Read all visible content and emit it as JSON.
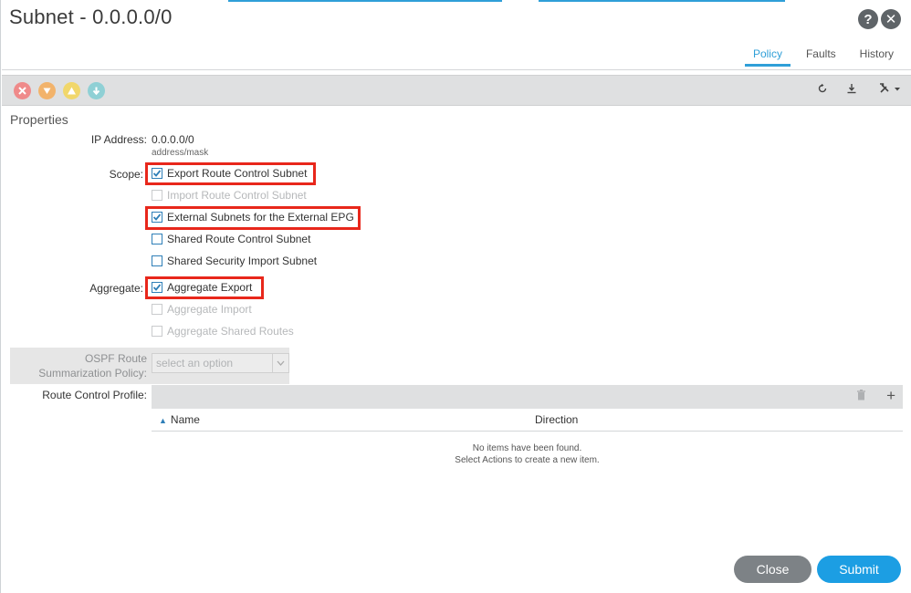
{
  "window": {
    "title": "Subnet - 0.0.0.0/0",
    "help_icon": "?",
    "close_icon": "✕"
  },
  "tabs": [
    {
      "label": "Policy",
      "active": true
    },
    {
      "label": "Faults",
      "active": false
    },
    {
      "label": "History",
      "active": false
    }
  ],
  "toolbar": {
    "fault_icons": [
      "critical-fault-icon",
      "major-fault-icon",
      "minor-fault-icon",
      "warning-fault-icon"
    ],
    "tools": [
      "refresh-icon",
      "download-icon",
      "tools-menu-icon"
    ]
  },
  "properties": {
    "section_title": "Properties",
    "ip_address": {
      "label": "IP Address:",
      "value": "0.0.0.0/0",
      "hint": "address/mask"
    },
    "scope": {
      "label": "Scope:",
      "options": [
        {
          "label": "Export Route Control Subnet",
          "checked": true,
          "disabled": false
        },
        {
          "label": "Import Route Control Subnet",
          "checked": false,
          "disabled": true
        },
        {
          "label": "External Subnets for the External EPG",
          "checked": true,
          "disabled": false
        },
        {
          "label": "Shared Route Control Subnet",
          "checked": false,
          "disabled": false
        },
        {
          "label": "Shared Security Import Subnet",
          "checked": false,
          "disabled": false
        }
      ]
    },
    "aggregate": {
      "label": "Aggregate:",
      "options": [
        {
          "label": "Aggregate Export",
          "checked": true,
          "disabled": false
        },
        {
          "label": "Aggregate Import",
          "checked": false,
          "disabled": true
        },
        {
          "label": "Aggregate Shared Routes",
          "checked": false,
          "disabled": true
        }
      ]
    },
    "ospf": {
      "label_line1": "OSPF Route",
      "label_line2": "Summarization Policy:",
      "placeholder": "select an option"
    },
    "route_control_profile": {
      "label": "Route Control Profile:",
      "columns": [
        "Name",
        "Direction"
      ],
      "empty_line1": "No items have been found.",
      "empty_line2": "Select Actions to create a new item."
    }
  },
  "buttons": {
    "close": "Close",
    "submit": "Submit"
  },
  "colors": {
    "accent": "#2f9fd8",
    "highlight": "#e8271b",
    "submit": "#1c9ee3",
    "close": "#7d8286"
  }
}
